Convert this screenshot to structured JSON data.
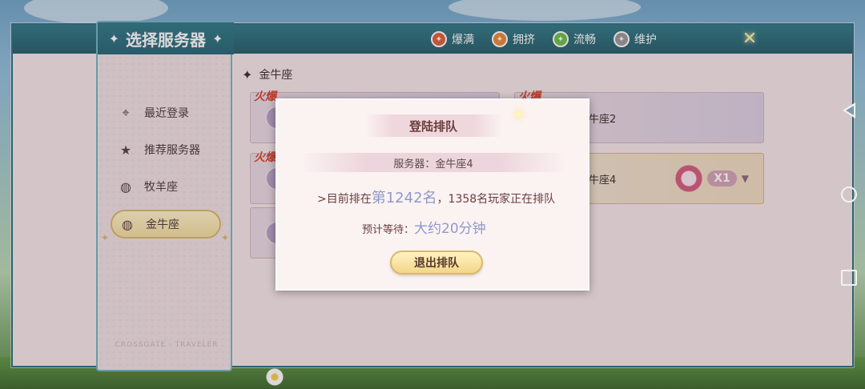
{
  "panel": {
    "title": "选择服务器",
    "footer": "CROSSGATE · TRAVELER",
    "items": [
      {
        "icon": "location-pin-icon",
        "label": "最近登录"
      },
      {
        "icon": "star-icon",
        "label": "推荐服务器"
      },
      {
        "icon": "globe-icon",
        "label": "牧羊座"
      },
      {
        "icon": "globe-icon",
        "label": "金牛座"
      }
    ]
  },
  "legend": [
    {
      "label": "爆满",
      "color": "#e0603a"
    },
    {
      "label": "拥挤",
      "color": "#e88a3a"
    },
    {
      "label": "流畅",
      "color": "#6cc04a"
    },
    {
      "label": "维护",
      "color": "#9a9a9a"
    }
  ],
  "content": {
    "section": "金牛座",
    "hot_label": "火爆",
    "cards": [
      {
        "name": "牛座2"
      },
      {
        "name": "牛座4"
      }
    ],
    "ticket_count": "X1"
  },
  "modal": {
    "title": "登陆排队",
    "server": "服务器：金牛座4",
    "rank_prefix": ">目前排在",
    "rank": "第1242名",
    "rank_suffix": "，1358名玩家正在排队",
    "wait_label": "预计等待：",
    "wait": "大约20分钟",
    "exit_label": "退出排队"
  }
}
